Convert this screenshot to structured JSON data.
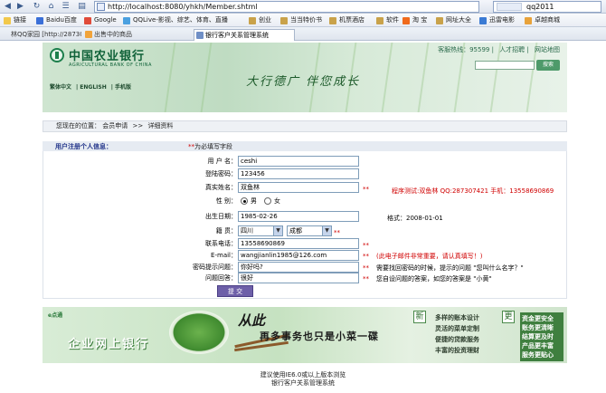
{
  "browser": {
    "url": "http://localhost:8080/yhkh/Member.shtml",
    "search_value": "qq2011",
    "favorites": [
      "链接",
      "Baidu百度",
      "Google",
      "QQLive-影视、综艺、体育、直播",
      "创业",
      "当当特价书",
      "机票酒店",
      "软件",
      "淘 宝",
      "网址大全",
      "迅雷电影",
      "卓越商城"
    ],
    "tabs": [
      "林QQ家园 [http://28730...",
      "出售中的商品",
      "银行客户关系管理系统"
    ],
    "colors": {
      "accent": "#d00000",
      "header_green": "#0f6138"
    }
  },
  "site": {
    "bank_name": "中国农业银行",
    "bank_name_en": "AGRICULTURAL BANK OF CHINA",
    "slogan": "大行德广  伴您成长",
    "top_links": [
      "客服热线：95599",
      "人才招聘",
      "网站地图"
    ],
    "search_button": "搜索",
    "lang_links": [
      "繁体中文",
      "ENGLISH",
      "手机版"
    ]
  },
  "breadcrumb": {
    "prefix": "您现在的位置：",
    "items": [
      "会员申请",
      "详细资料"
    ],
    "separator": ">>"
  },
  "form": {
    "section_title": "用户注册个人信息：",
    "required_hint_star": "**",
    "required_hint_text": "为必填写字段",
    "fields": {
      "username": {
        "label": "用 户 名：",
        "value": "ceshi"
      },
      "password": {
        "label": "登陆密码：",
        "value": "123456"
      },
      "realname": {
        "label": "真实姓名：",
        "value": "双鱼林",
        "star": "**",
        "note": "程序测试:双鱼林  QQ:287307421  手机：13558690869"
      },
      "gender": {
        "label": "性    别：",
        "options": [
          "男",
          "女"
        ],
        "selected": "男"
      },
      "birthday": {
        "label": "出生日期：",
        "value": "1985-02-26",
        "note": "格式：2008-01-01"
      },
      "native": {
        "label": "籍    贯：",
        "province": "四川",
        "city": "成都",
        "star": "**"
      },
      "phone": {
        "label": "联系电话：",
        "value": "13558690869",
        "star": "**"
      },
      "email": {
        "label": "E-mail：",
        "value": "wangjianlin1985@126.com",
        "star": "**",
        "note": "(此电子邮件非常重要，请认真填写！)"
      },
      "question": {
        "label": "密码提示问题：",
        "value": "你好吗?",
        "star": "**",
        "note": "需要找回密码的时候，提示的问题 \"您叫什么名字？\""
      },
      "answer": {
        "label": "问题回答：",
        "value": "很好",
        "star": "**",
        "note": "您自设问题的答案，如您的答案是 \"小黄\""
      }
    },
    "submit_label": "提 交"
  },
  "banner": {
    "logo": "e点通",
    "title": "企业网上银行",
    "headline": "从此",
    "subline": "再多事务也只是小菜一碟",
    "xin": "新",
    "geng": "更",
    "features": [
      "多样的账本设计",
      "灵活的菜单定制",
      "便捷的贷款服务",
      "丰富的投资理财"
    ],
    "grid": "资金更安全 账务更清晰 结算更及时 产品更丰富 服务更贴心"
  },
  "footer": {
    "line1": "建议使用IE6.0或以上版本浏览",
    "line2": "银行客户关系管理系统"
  }
}
